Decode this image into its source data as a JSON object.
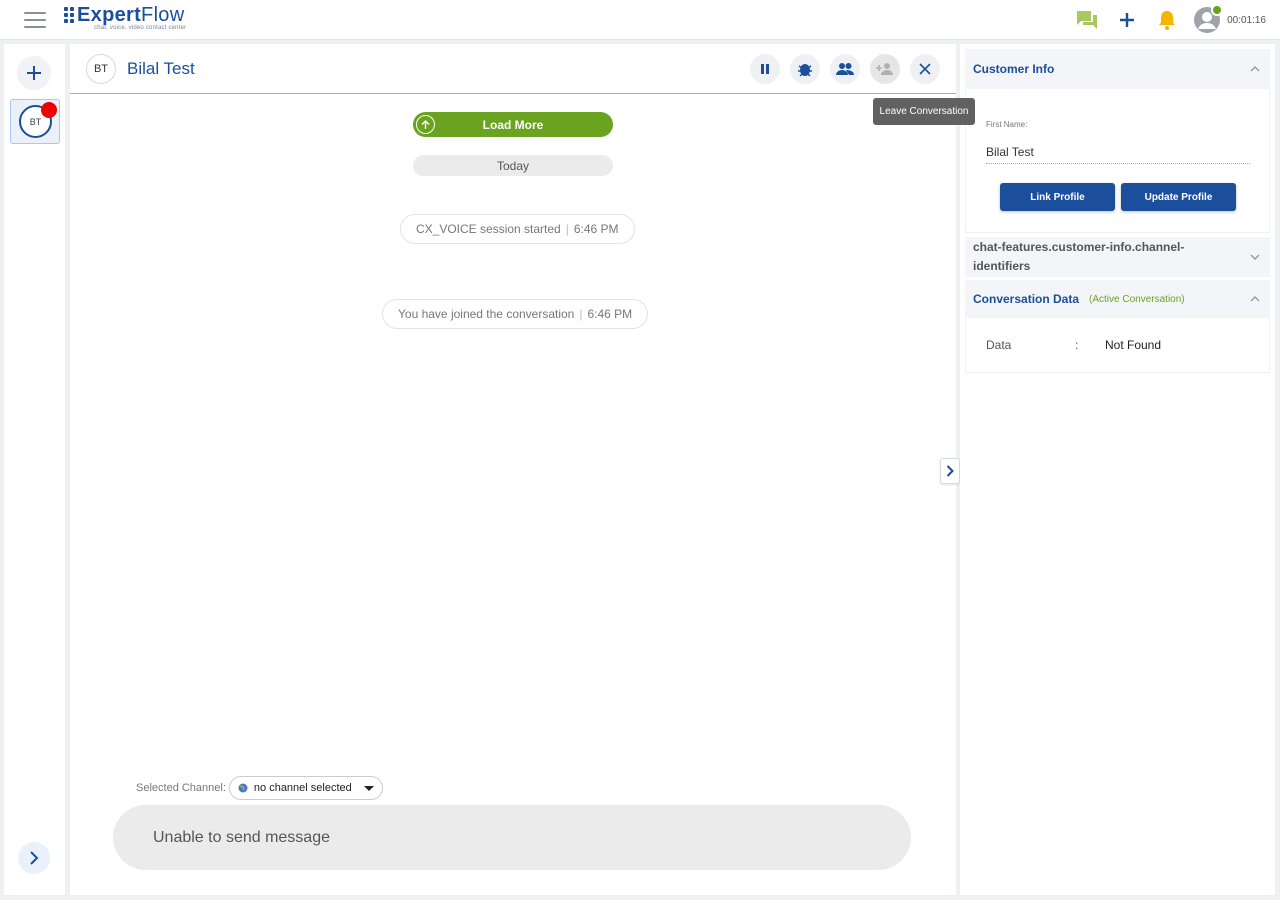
{
  "app": {
    "logo_prefix": "Expert",
    "logo_suffix": "Flow",
    "logo_tagline": "chat. voice. video contact center",
    "timer": "00:01:16"
  },
  "conversation": {
    "avatar_initials": "BT",
    "customer_name": "Bilal Test",
    "load_more_label": "Load More",
    "date_divider": "Today",
    "messages": [
      {
        "text": "CX_VOICE session started",
        "time": "6:46 PM"
      },
      {
        "text": "You have joined the conversation",
        "time": "6:46 PM"
      }
    ],
    "tooltip": "Leave Conversation",
    "channel_label": "Selected Channel:",
    "channel_value": "no channel selected",
    "input_text": "Unable to send message"
  },
  "sidebar": {
    "conversation_initials": "BT"
  },
  "customer_info": {
    "title": "Customer Info",
    "first_name_label": "First Name:",
    "first_name_value": "Bilal Test",
    "link_profile_label": "Link Profile",
    "update_profile_label": "Update Profile"
  },
  "channel_identifiers": {
    "title": "chat-features.customer-info.channel-identifiers"
  },
  "conversation_data": {
    "title": "Conversation Data",
    "status": "(Active Conversation)",
    "rows": [
      {
        "key": "Data",
        "sep": ":",
        "value": "Not Found"
      }
    ]
  },
  "colors": {
    "brand_blue": "#1b4f9c",
    "accent_green": "#6aa31f",
    "notification_yellow": "#f5b400",
    "badge_red": "#e00000"
  },
  "icons": [
    "menu-icon",
    "chat-icon",
    "plus-icon",
    "bell-icon",
    "user-avatar-icon",
    "pause-icon",
    "bug-icon",
    "group-icon",
    "add-person-icon",
    "close-icon",
    "chevron-right-icon",
    "chevron-up-icon",
    "chevron-down-icon",
    "globe-icon",
    "arrow-up-circle-icon"
  ]
}
